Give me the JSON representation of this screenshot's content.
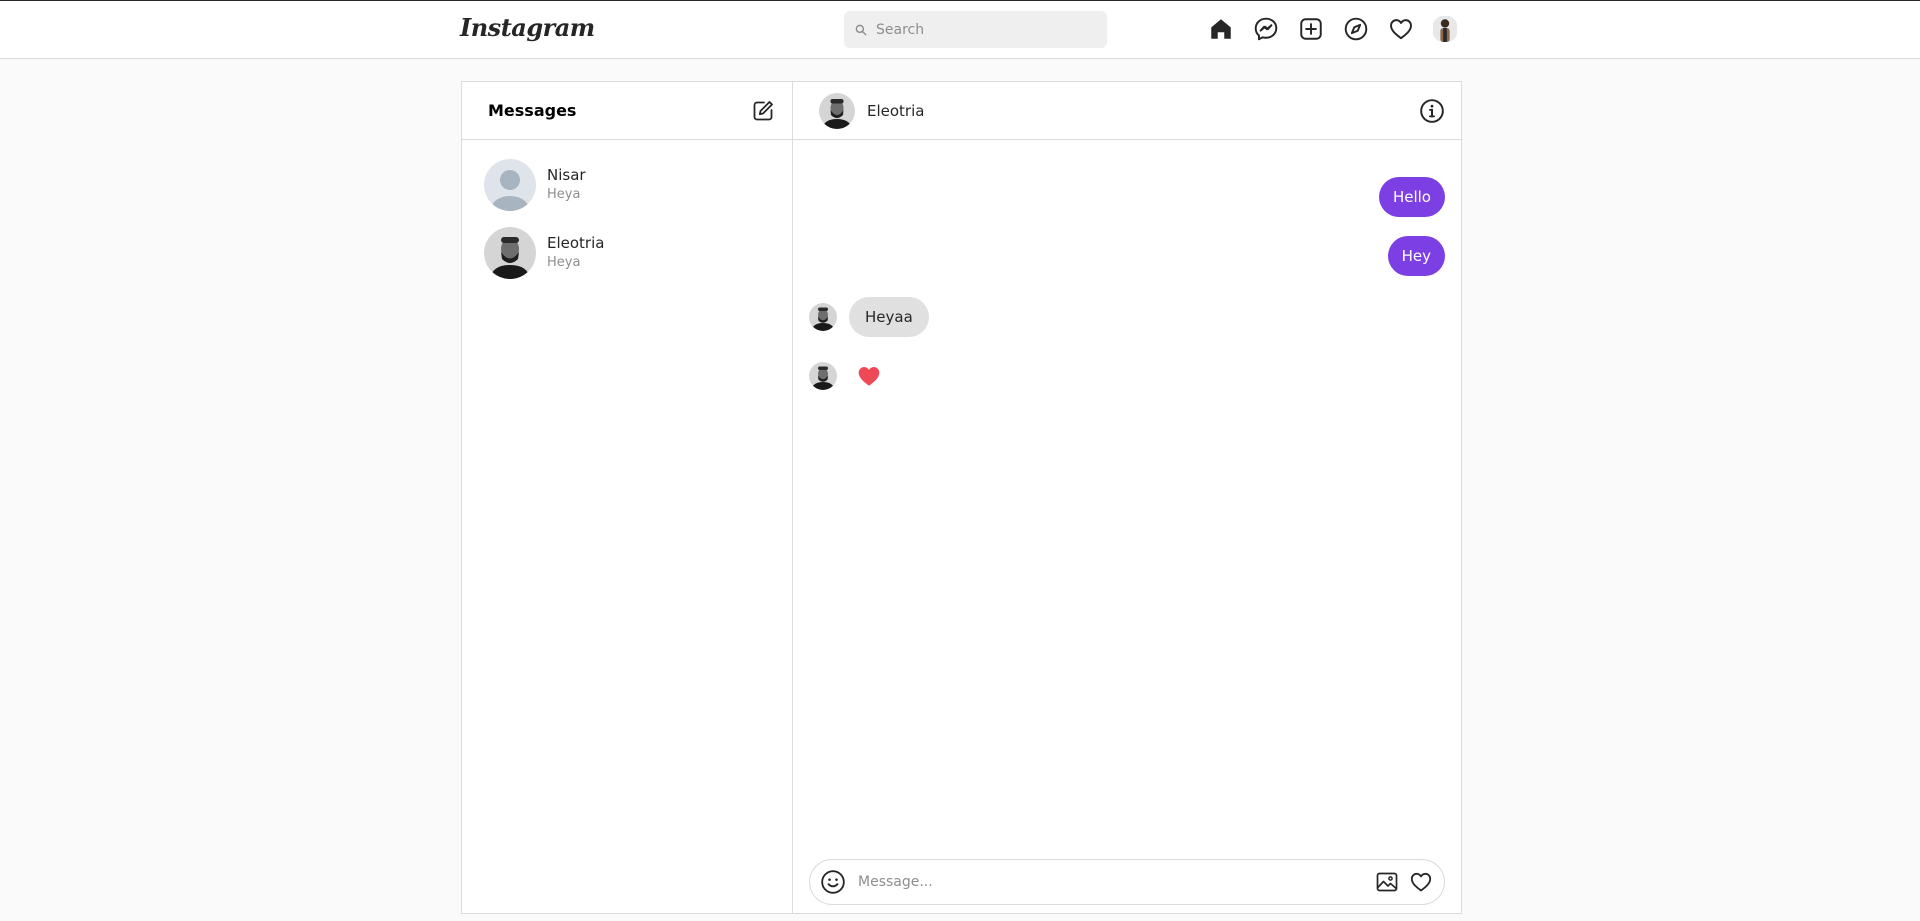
{
  "app": {
    "logo": "Instagram",
    "search_placeholder": "Search"
  },
  "nav": {
    "icons": [
      "home-icon",
      "messenger-icon",
      "new-post-icon",
      "explore-icon",
      "activity-heart-icon",
      "profile-avatar"
    ]
  },
  "inbox": {
    "title": "Messages",
    "conversations": [
      {
        "name": "Nisar",
        "preview": "Heya",
        "avatar": "default-avatar"
      },
      {
        "name": "Eleotria",
        "preview": "Heya",
        "avatar": "photo-avatar"
      }
    ]
  },
  "chat": {
    "title": "Eleotria",
    "messages": [
      {
        "from": "me",
        "text": "Hello"
      },
      {
        "from": "me",
        "text": "Hey"
      },
      {
        "from": "them",
        "text": "Heyaa"
      },
      {
        "from": "them",
        "type": "heart"
      }
    ],
    "composer_placeholder": "Message..."
  },
  "colors": {
    "accent": "#7b3fe4",
    "heart": "#ed4956",
    "incoming_bubble": "#e0e0e0",
    "border": "#dbdbdb",
    "background": "#fafafa"
  }
}
